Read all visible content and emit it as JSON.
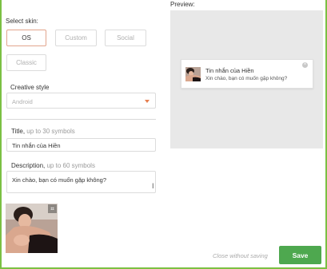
{
  "skin": {
    "label": "Select skin:",
    "options": [
      "OS",
      "Custom",
      "Social",
      "Classic"
    ],
    "selected": "OS"
  },
  "style": {
    "label": "Creative style",
    "value": "Android"
  },
  "title_field": {
    "label": "Title,",
    "hint": "up to 30 symbols",
    "value": "Tin nhắn của Hiền"
  },
  "description_field": {
    "label": "Description,",
    "hint": "up to 60 symbols",
    "value": "Xin chào, bạn có muốn gặp không?"
  },
  "preview": {
    "label": "Preview:",
    "notification": {
      "title": "Tin nhắn của Hiền",
      "text": "Xin chào, bạn có muốn gặp không?"
    }
  },
  "icons": {
    "dropdown": "chevron-down-icon",
    "crop": "crop-icon",
    "close": "close-icon",
    "text_cursor": "text-cursor-icon"
  },
  "footer": {
    "close_label": "Close without saving",
    "save_label": "Save"
  },
  "colors": {
    "accent_border": "#e2a58d",
    "dropdown_caret": "#e67e4f",
    "save_button": "#4ea84f",
    "frame_border": "#7bc043"
  }
}
